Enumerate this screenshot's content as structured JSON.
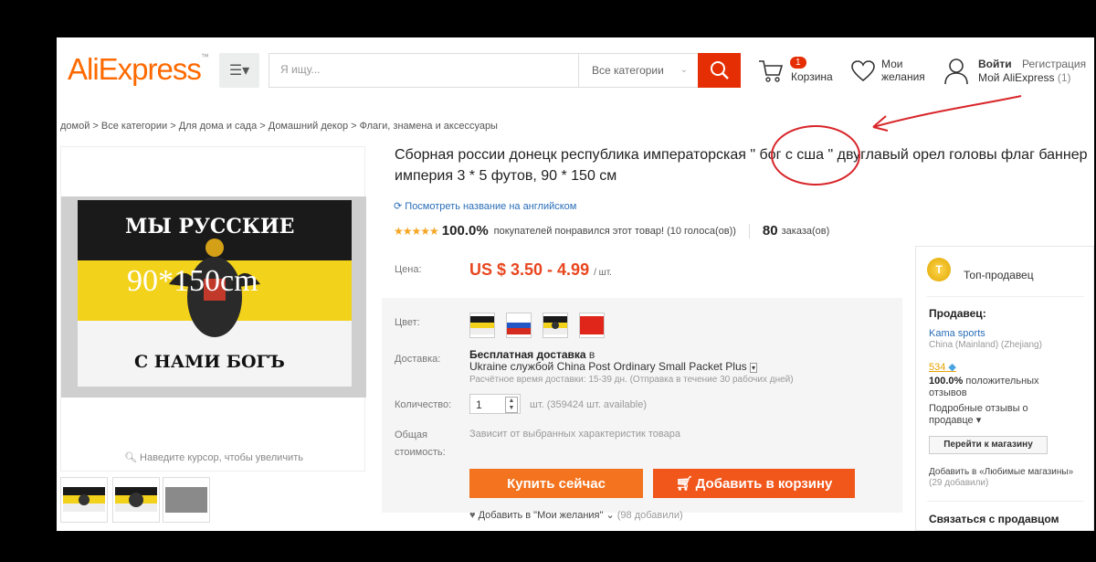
{
  "header": {
    "logo_main": "AliExpress",
    "logo_mark": "™",
    "menu_icon": "☰▾",
    "search_placeholder": "Я ищу...",
    "search_category": "Все категории",
    "cart_count": "1",
    "cart_label": "Корзина",
    "wish_label": "Мои желания",
    "login": "Войти",
    "register": "Регистрация",
    "my_account": "Мой AliExpress",
    "my_account_count": "(1)"
  },
  "breadcrumb": "домой > Все категории > Для дома и сада > Домашний декор > Флаги, знамена и аксессуары",
  "gallery": {
    "flag_top_text": "МЫ РУССКИЕ",
    "flag_size_text": "90*150cm",
    "flag_bottom_text": "С НАМИ БОГЪ",
    "zoom_hint": "Наведите курсор, чтобы увеличить"
  },
  "product": {
    "title_part1": "Сборная россии донецк республика императорская",
    "title_highlight": "\" бог с сша \"",
    "title_part2": "двуглавый орел головы флаг баннер империя 3 * 5 футов, 90 * 150 см",
    "english_link": "Посмотреть название на английском",
    "stars": "★★★★★",
    "rating_pct": "100.0%",
    "rating_text": "покупателей понравился этот товар! (10 голоса(ов))",
    "orders_count": "80",
    "orders_label": "заказа(ов)"
  },
  "price": {
    "label": "Цена:",
    "value": "US $ 3.50 - 4.99",
    "unit": "/ шт."
  },
  "options": {
    "color_label": "Цвет:",
    "shipping_label": "Доставка:",
    "shipping_free": "Бесплатная доставка",
    "shipping_in": "в",
    "shipping_service": "Ukraine службой China Post Ordinary Small Packet Plus",
    "shipping_time": "Расчётное время доставки: 15-39 дн. (Отправка в течение 30 рабочих дней)",
    "qty_label": "Количество:",
    "qty_value": "1",
    "qty_available": "шт. (359424 шт. available)",
    "total_label_1": "Общая",
    "total_label_2": "стоимость:",
    "total_value": "Зависит от выбранных характеристик товара"
  },
  "actions": {
    "buy_now": "Купить сейчас",
    "add_to_cart": "Добавить в корзину",
    "add_wish": "Добавить в \"Мои желания\"",
    "add_wish_count": "(98 добавили)"
  },
  "seller": {
    "top_seller": "Топ-продавец",
    "heading": "Продавец:",
    "name": "Kama sports",
    "location": "China (Mainland) (Zhejiang)",
    "score": "534",
    "feedback_pct": "100.0%",
    "feedback_text": "положительных отзывов",
    "details": "Подробные отзывы о продавце",
    "store_button": "Перейти к магазину",
    "fav_text": "Добавить в «Любимые магазины»",
    "fav_count": "(29 добавили)",
    "contact": "Связаться с продавцом"
  },
  "colors": {
    "accent": "#e62e04",
    "orange": "#ff6a00",
    "price": "#e8461f",
    "link": "#2a6eb8",
    "annotation": "#d8262a"
  }
}
